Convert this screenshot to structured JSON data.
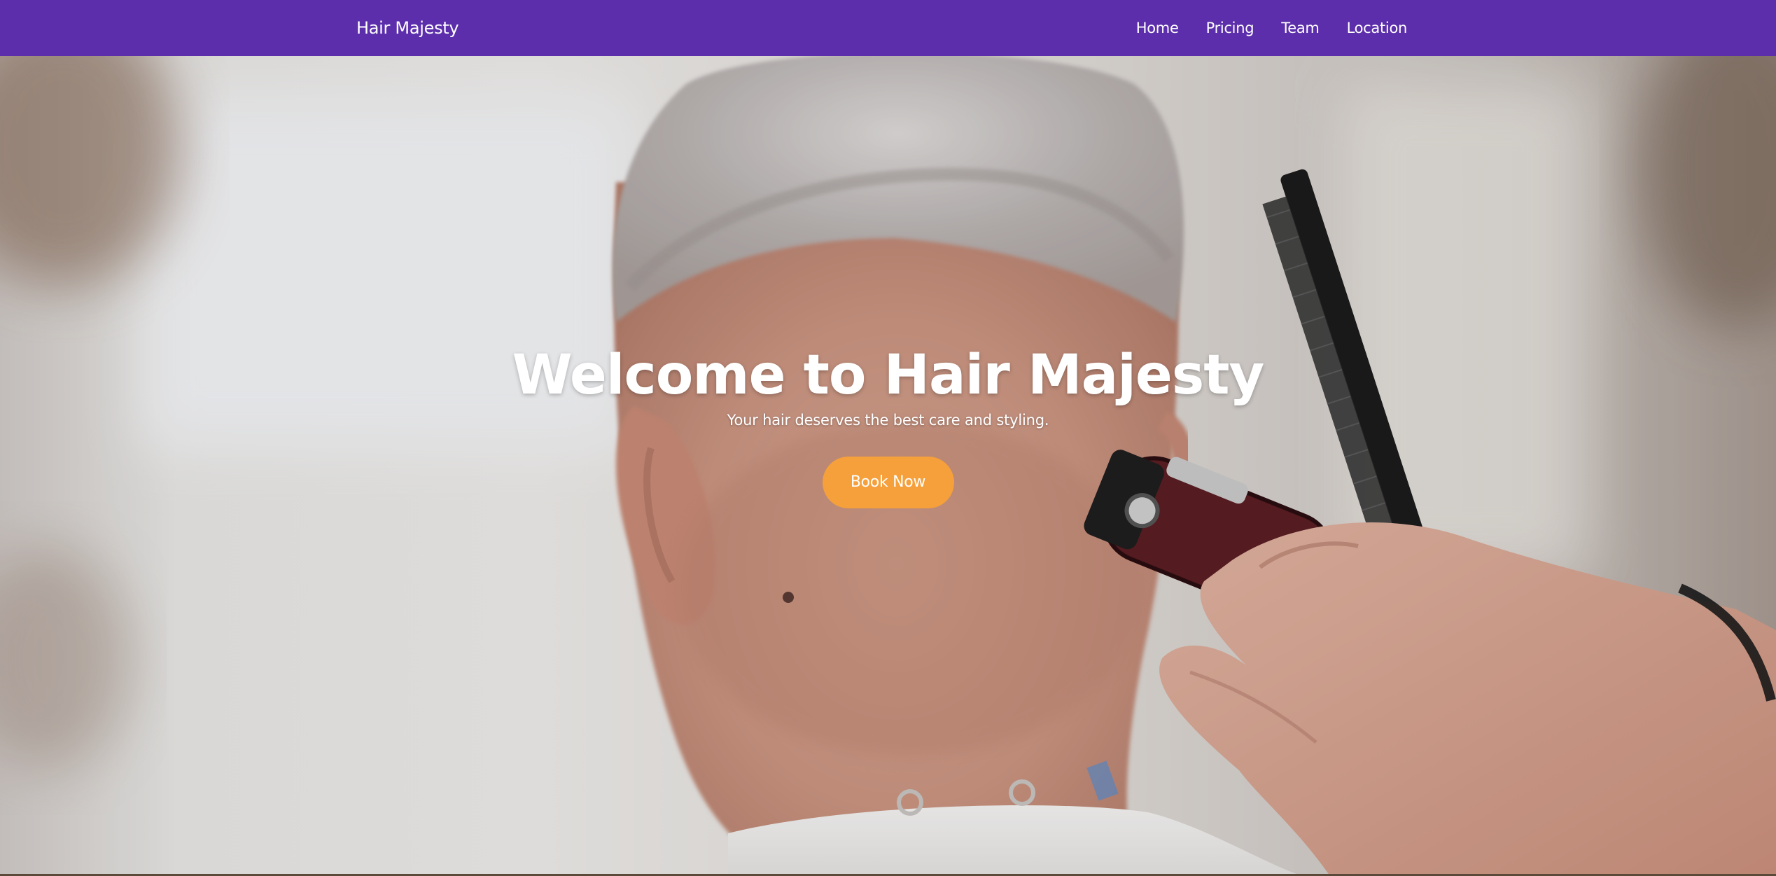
{
  "navbar": {
    "brand": "Hair Majesty",
    "links": [
      "Home",
      "Pricing",
      "Team",
      "Location"
    ],
    "background_color": "#5c2eab"
  },
  "hero": {
    "title": "Welcome to Hair Majesty",
    "subtitle": "Your hair deserves the best care and styling.",
    "cta_label": "Book Now",
    "cta_color": "#f5a03a",
    "background_image": "barber-haircut-photo"
  }
}
